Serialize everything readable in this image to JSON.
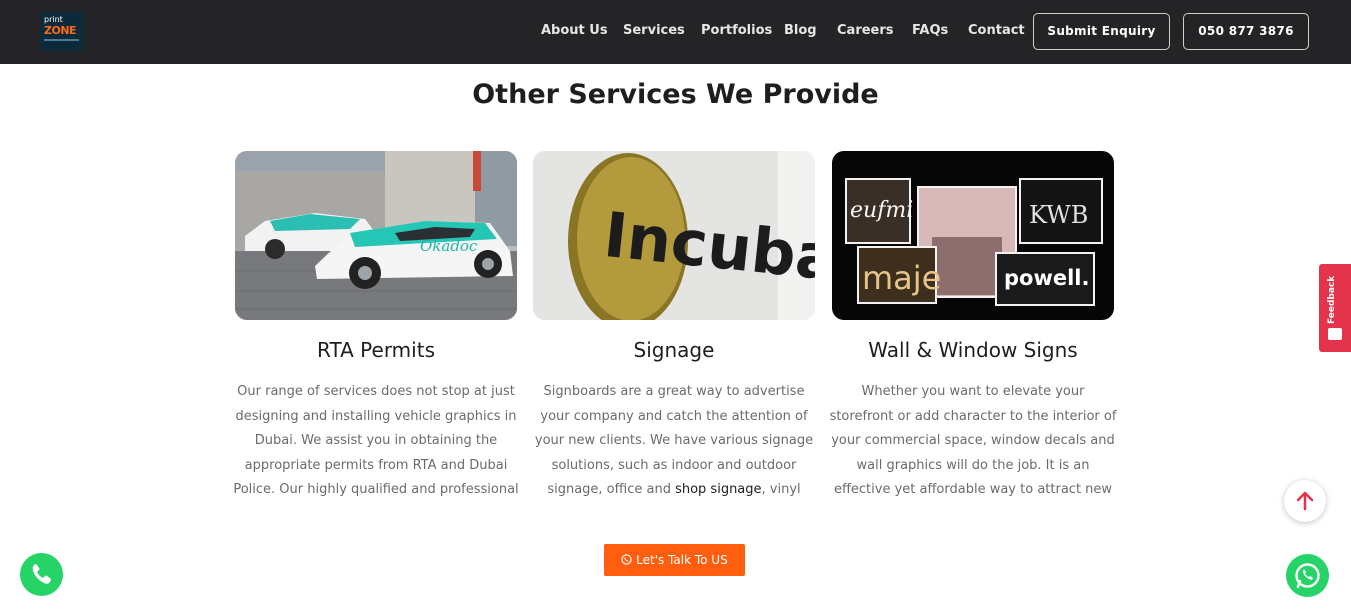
{
  "header": {
    "logo": {
      "line1": "print",
      "line2": "ZONE"
    },
    "nav": [
      "About Us",
      "Services",
      "Portfolios",
      "Blog",
      "Careers",
      "FAQs",
      "Contact"
    ],
    "submit_label": "Submit Enquiry",
    "phone_label": "050 877 3876"
  },
  "section": {
    "title": "Other Services We Provide",
    "cards": [
      {
        "title": "RTA Permits",
        "image": "vehicle-graphics-photo",
        "text": "Our range of services does not stop at just designing and installing vehicle graphics in Dubai. We assist you in obtaining the appropriate permits from RTA and Dubai Police. Our highly qualified and professional"
      },
      {
        "title": "Signage",
        "image": "incubayt-sign-photo",
        "text_before_link": "Signboards are a great way to advertise your company and catch the attention of your new clients. We have various signage solutions, such as indoor and outdoor signage, office and ",
        "link": "shop signage",
        "text_after_link": ", vinyl"
      },
      {
        "title": "Wall & Window Signs",
        "image": "shop-signs-collage-photo",
        "text": "Whether you want to elevate your storefront or add character to the interior of your commercial space, window decals and wall graphics will do the job. It is an effective yet affordable way to attract new clientele."
      }
    ],
    "cta_label": "Let's Talk To US"
  },
  "signs": {
    "incubayt": "Incubayt",
    "car_brand": "Okadoc",
    "sign1": "eufmi",
    "sign2": "maje",
    "sign3": "KWB",
    "sign4": "powell."
  },
  "feedback_label": "Feedback",
  "colors": {
    "header_bg": "#242426",
    "accent": "#ff5e0e",
    "feedback": "#e4344c",
    "whatsapp": "#25d366"
  }
}
